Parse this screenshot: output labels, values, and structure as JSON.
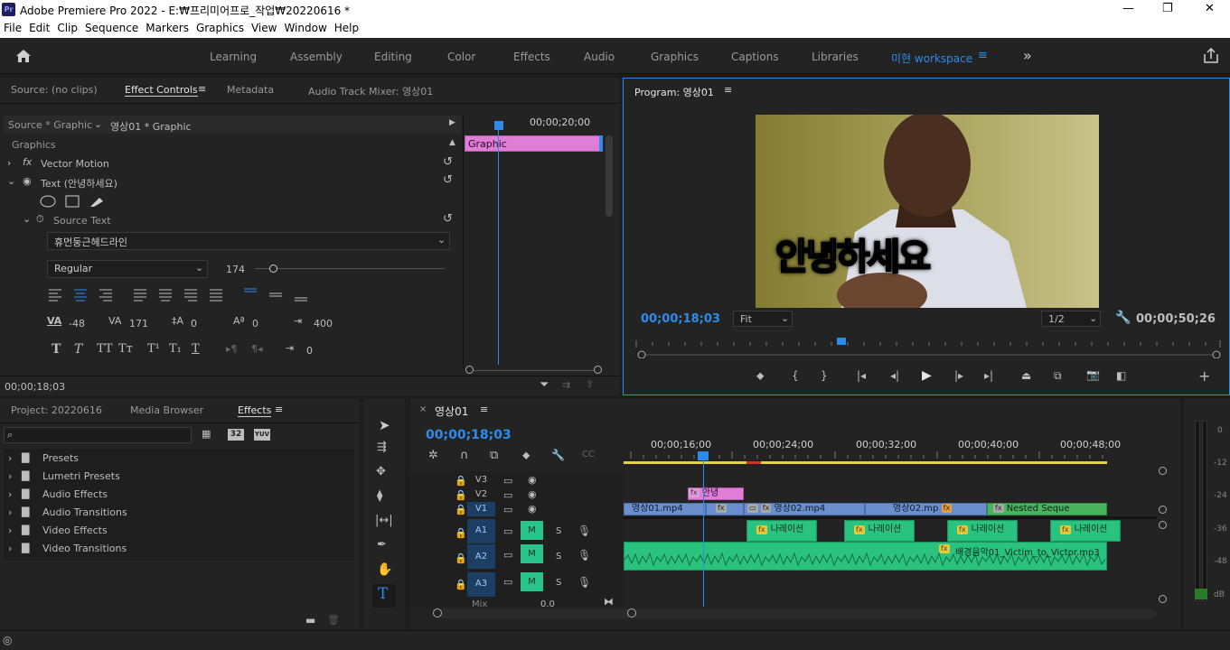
{
  "window": {
    "title": "Adobe Premiere Pro 2022 - E:₩프리미어프로_작업₩20220616 *",
    "logo": "Pr",
    "min": "—",
    "max": "❐",
    "close": "✕"
  },
  "menu": [
    "File",
    "Edit",
    "Clip",
    "Sequence",
    "Markers",
    "Graphics",
    "View",
    "Window",
    "Help"
  ],
  "workspaces": [
    "Learning",
    "Assembly",
    "Editing",
    "Color",
    "Effects",
    "Audio",
    "Graphics",
    "Captions",
    "Libraries"
  ],
  "active_workspace": "미현 workspace",
  "effect_panel": {
    "tabs": [
      "Source: (no clips)",
      "Effect Controls",
      "Metadata",
      "Audio Track Mixer: 영상01"
    ],
    "source_label": "Source * Graphic",
    "seq_label": "영상01 * Graphic",
    "timecode_right": "00;00;20;00",
    "graphic_clip": "Graphic",
    "section": "Graphics",
    "vector_motion": "Vector Motion",
    "text_label": "Text (안녕하세요)",
    "source_text": "Source Text",
    "font": "휴먼둥근헤드라인",
    "style": "Regular",
    "size": "174",
    "kerning": "-48",
    "tracking": "171",
    "leading": "0",
    "baseline": "0",
    "tsume": "400",
    "indent": "0",
    "timecode": "00;00;18;03"
  },
  "program": {
    "title": "Program: 영상01",
    "timecode": "00;00;18;03",
    "fit": "Fit",
    "res": "1/2",
    "duration": "00;00;50;26",
    "subtitle_a": "안녕",
    "subtitle_b": "하세요"
  },
  "project": {
    "tabs": [
      "Project: 20220616",
      "Media Browser",
      "Effects"
    ],
    "items": [
      "Presets",
      "Lumetri Presets",
      "Audio Effects",
      "Audio Transitions",
      "Video Effects",
      "Video Transitions"
    ],
    "badge32": "32",
    "badgeyuv": "YUV"
  },
  "timeline": {
    "tab": "영상01",
    "timecode": "00;00;18;03",
    "ruler": [
      "00;00;16;00",
      "00;00;24;00",
      "00;00;32;00",
      "00;00;40;00",
      "00;00;48;00"
    ],
    "tracks_v": [
      "V3",
      "V2",
      "V1"
    ],
    "tracks_a": [
      "A1",
      "A2",
      "A3"
    ],
    "mix": "Mix",
    "mix_val": "0.0",
    "m": "M",
    "s": "S",
    "clips": {
      "v2": "안녕",
      "v1a": "영상01.mp4",
      "v1b": "영상02.mp4",
      "v1c": "영상02.mp",
      "v1d": "Nested Seque",
      "narr": "나레이션",
      "bgm": "배경음악01_Victim_to_Victor.mp3"
    }
  },
  "meter": [
    "0",
    "-12",
    "-24",
    "-36",
    "-48",
    "dB"
  ]
}
